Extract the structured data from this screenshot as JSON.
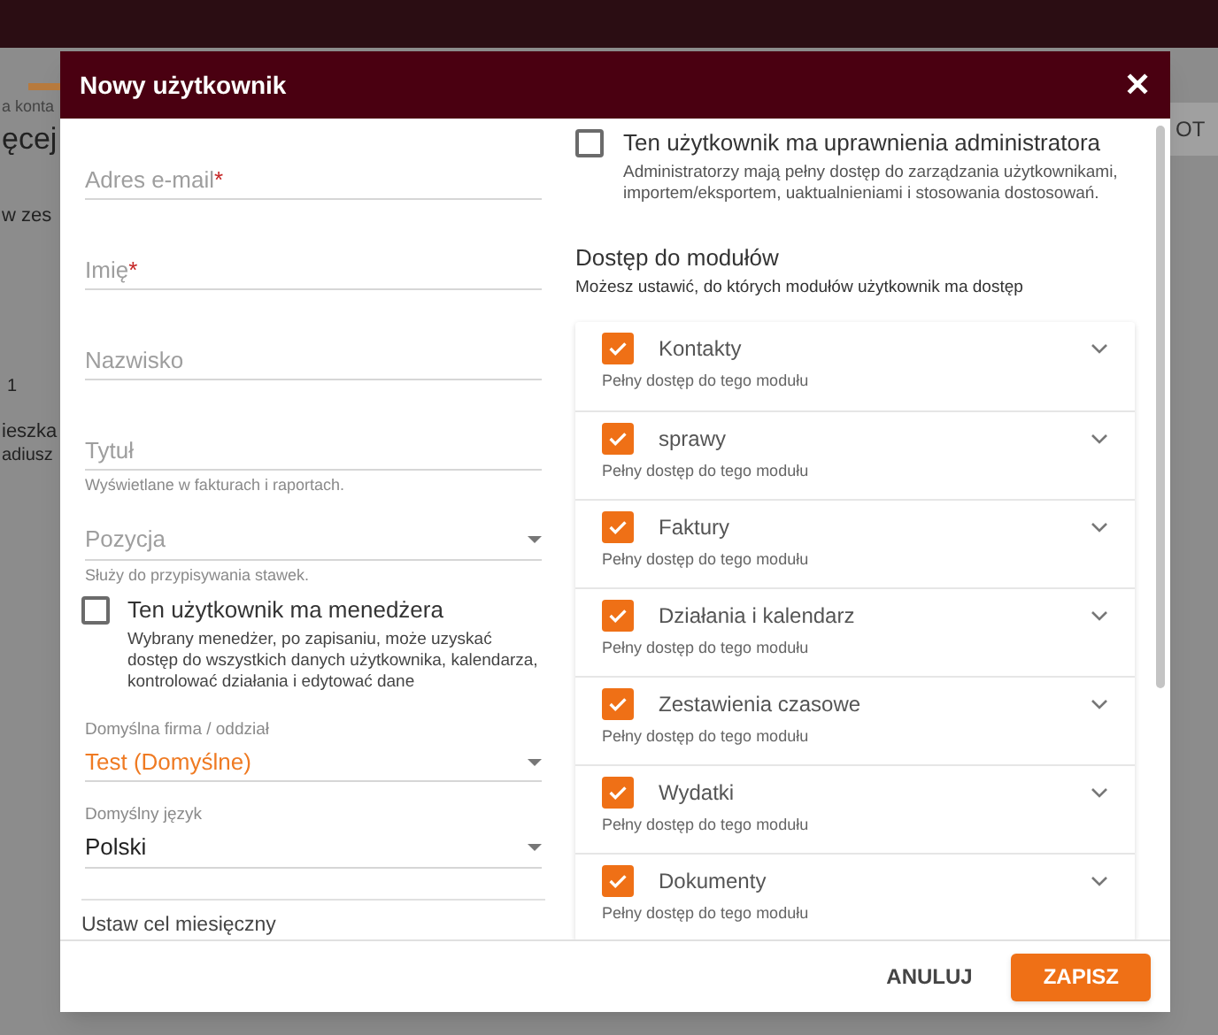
{
  "background": {
    "fragments": [
      "a konta",
      "ęcej",
      "w zes",
      "1",
      "ieszka",
      "adiusz"
    ],
    "button": "OT"
  },
  "dialog": {
    "title": "Nowy użytkownik",
    "close": "✕"
  },
  "fields": [
    {
      "kind": "text",
      "placeholder": "Adres e-mail",
      "required_mark": "*"
    },
    {
      "kind": "text",
      "placeholder": "Imię",
      "required_mark": "*"
    },
    {
      "kind": "text",
      "placeholder": "Nazwisko"
    },
    {
      "kind": "text",
      "placeholder": "Tytuł",
      "hint": "Wyświetlane w fakturach i raportach."
    },
    {
      "kind": "select",
      "placeholder": "Pozycja",
      "hint": "Służy do przypisywania stawek."
    }
  ],
  "manager": {
    "label": "Ten użytkownik ma menedżera",
    "description": "Wybrany menedżer, po zapisaniu, może uzyskać dostęp do wszystkich danych użytkownika, kalendarza, kontrolować działania i edytować dane",
    "checked": false
  },
  "selects": [
    {
      "label": "Domyślna firma / oddział",
      "value": "Test (Domyślne)",
      "highlighted": true
    },
    {
      "label": "Domyślny język",
      "value": "Polski",
      "highlighted": false
    }
  ],
  "goal": {
    "label": "Ustaw cel miesięczny"
  },
  "admin": {
    "label": "Ten użytkownik ma uprawnienia administratora",
    "description": "Administratorzy mają pełny dostęp do zarządzania użytkownikami, importem/eksportem, uaktualnieniami i stosowania dostosowań.",
    "checked": false
  },
  "modules": {
    "title": "Dostęp do modułów",
    "subtitle": "Możesz ustawić, do których modułów użytkownik ma dostęp",
    "items": [
      {
        "name": "Kontakty",
        "access": "Pełny dostęp do tego modułu",
        "checked": true
      },
      {
        "name": "sprawy",
        "access": "Pełny dostęp do tego modułu",
        "checked": true
      },
      {
        "name": "Faktury",
        "access": "Pełny dostęp do tego modułu",
        "checked": true
      },
      {
        "name": "Działania i kalendarz",
        "access": "Pełny dostęp do tego modułu",
        "checked": true
      },
      {
        "name": "Zestawienia czasowe",
        "access": "Pełny dostęp do tego modułu",
        "checked": true
      },
      {
        "name": "Wydatki",
        "access": "Pełny dostęp do tego modułu",
        "checked": true
      },
      {
        "name": "Dokumenty",
        "access": "Pełny dostęp do tego modułu",
        "checked": true
      }
    ]
  },
  "buttons": [
    {
      "kind": "secondary",
      "label": "ANULUJ"
    },
    {
      "kind": "primary",
      "label": "ZAPISZ"
    }
  ]
}
